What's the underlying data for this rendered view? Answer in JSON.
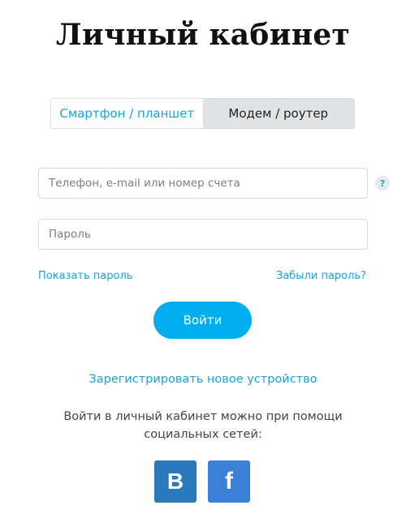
{
  "page": {
    "title": "Личный кабинет"
  },
  "tabs": [
    {
      "label": "Смартфон / планшет",
      "active": true
    },
    {
      "label": "Модем / роутер",
      "active": false
    }
  ],
  "form": {
    "login_placeholder": "Телефон, e-mail или номер счета",
    "login_value": "",
    "password_placeholder": "Пароль",
    "password_value": "",
    "help_label": "?",
    "show_password_label": "Показать пароль",
    "forgot_password_label": "Забыли пароль?",
    "submit_label": "Войти"
  },
  "register": {
    "label": "Зарегистрировать новое устройство"
  },
  "social": {
    "text": "Войти в личный кабинет можно при помощи социальных сетей:",
    "vk_label": "В",
    "fb_label": "f",
    "vk_icon": "vk-icon",
    "fb_icon": "facebook-icon",
    "colors": {
      "vk": "#2a79bd",
      "fb": "#3b80d8"
    }
  },
  "colors": {
    "accent": "#00adef",
    "link": "#1aa3d9",
    "inactive_tab": "#e0e2e4"
  }
}
